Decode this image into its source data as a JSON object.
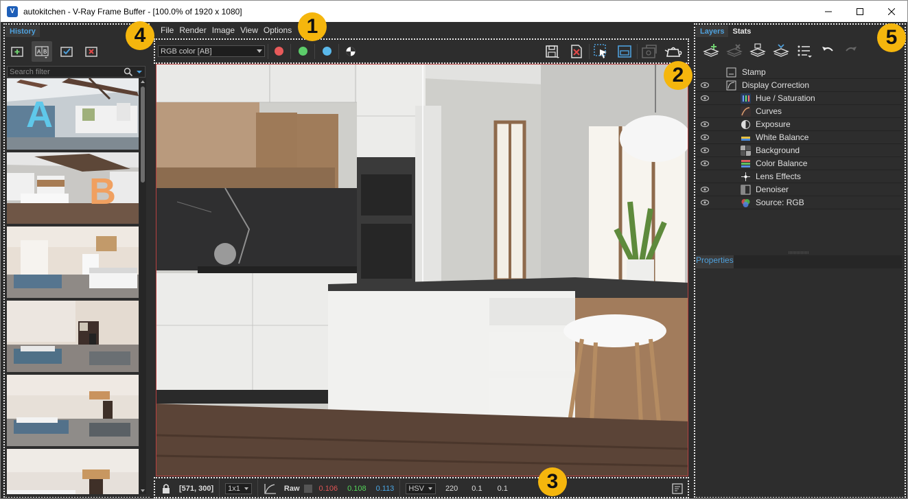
{
  "window": {
    "app_icon_glyph": "V",
    "title": "autokitchen - V-Ray Frame Buffer - [100.0% of 1920 x 1080]",
    "buttons": [
      "minimize-icon",
      "maximize-icon",
      "close-icon"
    ]
  },
  "menu": [
    "File",
    "Render",
    "Image",
    "View",
    "Options"
  ],
  "history": {
    "tab": "History",
    "tools": [
      "save-to-history-icon",
      "ab-compare-icon",
      "set-a-icon",
      "remove-icon"
    ],
    "search_placeholder": "Search filter",
    "thumbnails": [
      {
        "label": "A",
        "color": "#5fc8ea"
      },
      {
        "label": "B",
        "color": "#f0a060"
      },
      {
        "label": ""
      },
      {
        "label": ""
      },
      {
        "label": ""
      },
      {
        "label": ""
      }
    ]
  },
  "viewer": {
    "channel": "RGB color [AB]",
    "channel_dots": [
      {
        "name": "red-channel-button",
        "color": "#e85a5a"
      },
      {
        "name": "green-channel-button",
        "color": "#5ccc6a"
      },
      {
        "name": "blue-channel-button",
        "color": "#5ab8ea"
      }
    ],
    "right_tools": [
      "save-image-icon",
      "clear-image-icon",
      "region-render-icon",
      "render-region-icon",
      "render-last-icon",
      "teapot-render-icon"
    ]
  },
  "status": {
    "coords": "[571, 300]",
    "ratio": "1x1",
    "raw_label": "Raw",
    "r": "0.106",
    "g": "0.108",
    "b": "0.113",
    "r_color": "#e05454",
    "g_color": "#54d65a",
    "b_color": "#4aa8e8",
    "mode": "HSV",
    "h": "220",
    "s": "0.1",
    "v": "0.1"
  },
  "layers": {
    "tabs": [
      "Layers",
      "Stats"
    ],
    "tools": [
      "add-layer-icon",
      "delete-layer-icon",
      "load-layers-icon",
      "save-layers-icon",
      "layer-options-icon",
      "undo-icon",
      "redo-icon"
    ],
    "items": [
      {
        "name": "Stamp",
        "visible": false,
        "indent": 0,
        "icon": "stamp-icon",
        "icolor": "#cfcfcf"
      },
      {
        "name": "Display Correction",
        "visible": true,
        "indent": 0,
        "icon": "display-correction-icon",
        "icolor": "#cfcfcf"
      },
      {
        "name": "Hue / Saturation",
        "visible": true,
        "indent": 1,
        "icon": "hue-saturation-icon",
        "icolor": "#4f86d6"
      },
      {
        "name": "Curves",
        "visible": false,
        "indent": 1,
        "icon": "curves-icon",
        "icolor": "#e0a070"
      },
      {
        "name": "Exposure",
        "visible": true,
        "indent": 1,
        "icon": "exposure-icon",
        "icolor": "#d0d0d0"
      },
      {
        "name": "White Balance",
        "visible": true,
        "indent": 1,
        "icon": "white-balance-icon",
        "icolor": "#e8c040"
      },
      {
        "name": "Background",
        "visible": true,
        "indent": 1,
        "icon": "background-icon",
        "icolor": "#909090"
      },
      {
        "name": "Color Balance",
        "visible": true,
        "indent": 1,
        "icon": "color-balance-icon",
        "icolor": "#58b060"
      },
      {
        "name": "Lens Effects",
        "visible": false,
        "indent": 1,
        "icon": "lens-effects-icon",
        "icolor": "#d0d0d0"
      },
      {
        "name": "Denoiser",
        "visible": true,
        "indent": 1,
        "icon": "denoiser-icon",
        "icolor": "#b0b0b0"
      },
      {
        "name": "Source: RGB",
        "visible": true,
        "indent": 1,
        "icon": "source-rgb-icon",
        "icolor": "#e05050"
      }
    ],
    "properties_tab": "Properties"
  },
  "callouts": [
    "1",
    "2",
    "3",
    "4",
    "5"
  ]
}
